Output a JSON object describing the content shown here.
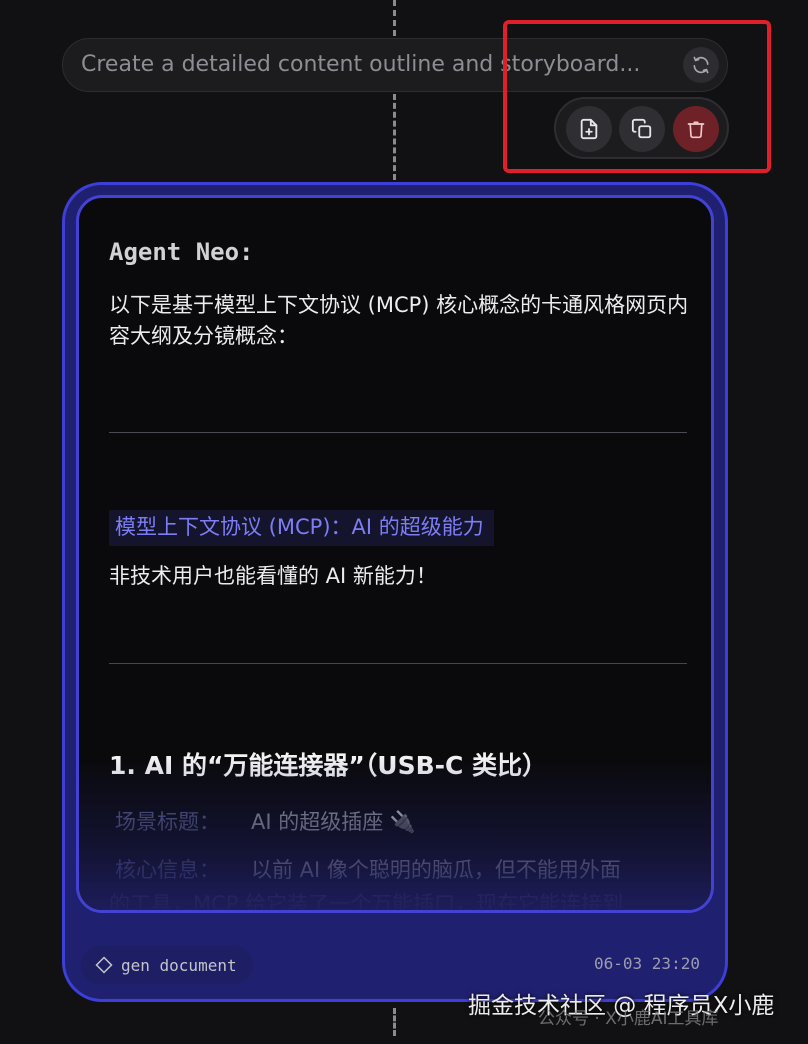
{
  "prompt": {
    "text": "Create a detailed content outline and storyboard...",
    "refresh_icon": "refresh-icon"
  },
  "actions": [
    {
      "name": "insert-document-button",
      "icon": "file-plus-icon"
    },
    {
      "name": "copy-button",
      "icon": "copy-icon"
    },
    {
      "name": "delete-button",
      "icon": "trash-icon"
    }
  ],
  "card": {
    "agent_name": "Agent Neo:",
    "intro": "以下是基于模型上下文协议 (MCP) 核心概念的卡通风格网页内容大纲及分镜概念：",
    "subtitle": "模型上下文协议 (MCP)：AI 的超级能力",
    "tagline": "非技术用户也能看懂的 AI 新能力！",
    "section_title": "1. AI 的“万能连接器”（USB-C 类比）",
    "fields": [
      {
        "label": "场景标题：",
        "value": "AI 的超级插座 🔌"
      },
      {
        "label": "核心信息：",
        "value": "以前 AI 像个聪明的脑瓜，但不能用外面"
      }
    ],
    "overflow_text": "的工具，MCP 给它装了一个万能插口，现在它能连接到"
  },
  "footer": {
    "tag_icon": "diamond-icon",
    "tag_label": "gen document",
    "timestamp": "06-03 23:20"
  },
  "watermark": {
    "line1": "掘金技术社区 @ 程序员X小鹿",
    "line2": "公众号 · X小鹿AI工具库"
  },
  "colors": {
    "accent": "#4343d3",
    "highlight_text": "#7d7df5",
    "annotation_red": "#e11f2b",
    "delete": "#6e2227"
  }
}
